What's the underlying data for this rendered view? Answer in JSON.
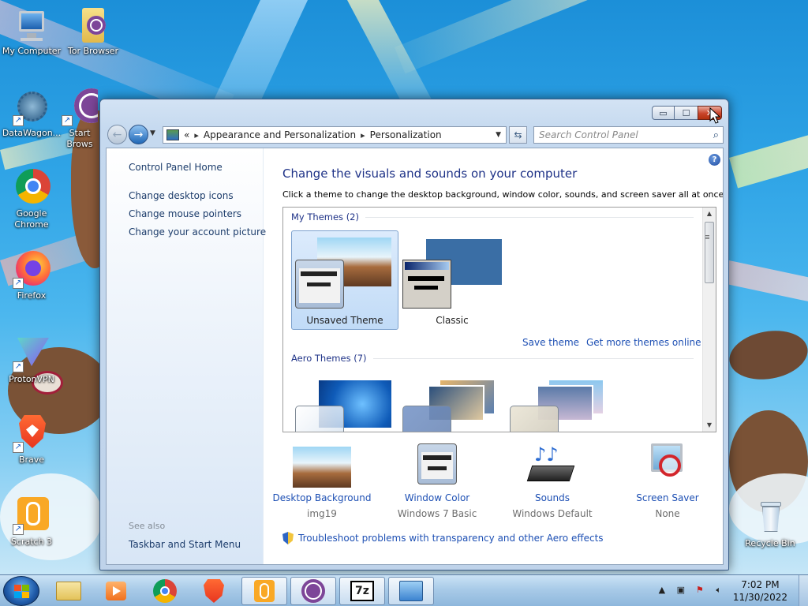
{
  "desktop": {
    "icons": [
      {
        "label": "My Computer",
        "icon": "computer-icon"
      },
      {
        "label": "Tor Browser",
        "icon": "tor-browser-icon"
      },
      {
        "label": "DataWagon...",
        "icon": "datawagon-icon"
      },
      {
        "label": "Start\nBrows",
        "icon": "start-browser-icon"
      },
      {
        "label": "Google\nChrome",
        "icon": "chrome-icon"
      },
      {
        "label": "Firefox",
        "icon": "firefox-icon"
      },
      {
        "label": "ProtonVPN",
        "icon": "protonvpn-icon"
      },
      {
        "label": "Brave",
        "icon": "brave-icon"
      },
      {
        "label": "Scratch 3",
        "icon": "scratch-icon"
      },
      {
        "label": "Recycle Bin",
        "icon": "recycle-bin-icon"
      }
    ]
  },
  "window": {
    "caption_buttons": {
      "minimize": "▭",
      "maximize": "☐",
      "close": "✕"
    },
    "address": {
      "chevron": "«",
      "crumbs": [
        "Appearance and Personalization",
        "Personalization"
      ],
      "separator": "▸"
    },
    "search": {
      "placeholder": "Search Control Panel"
    },
    "sidebar": {
      "home": "Control Panel Home",
      "links": [
        "Change desktop icons",
        "Change mouse pointers",
        "Change your account picture"
      ],
      "see_also_label": "See also",
      "see_also_links": [
        "Taskbar and Start Menu"
      ]
    },
    "main": {
      "heading": "Change the visuals and sounds on your computer",
      "subtext": "Click a theme to change the desktop background, window color, sounds, and screen saver all at once.",
      "groups": [
        {
          "title": "My Themes (2)"
        },
        {
          "title": "Aero Themes (7)"
        }
      ],
      "my_themes": [
        {
          "label": "Unsaved Theme",
          "selected": true
        },
        {
          "label": "Classic",
          "selected": false
        }
      ],
      "save_theme": "Save theme",
      "more_themes": "Get more themes online",
      "bottom": [
        {
          "title": "Desktop Background",
          "sub": "img19",
          "icon": "desktop-background-icon"
        },
        {
          "title": "Window Color",
          "sub": "Windows 7 Basic",
          "icon": "window-color-icon"
        },
        {
          "title": "Sounds",
          "sub": "Windows Default",
          "icon": "sounds-icon"
        },
        {
          "title": "Screen Saver",
          "sub": "None",
          "icon": "screen-saver-icon"
        }
      ],
      "troubleshoot": "Troubleshoot problems with transparency and other Aero effects"
    }
  },
  "taskbar": {
    "pinned": [
      "file-explorer-icon",
      "media-player-icon",
      "chrome-icon",
      "brave-icon",
      "scratch-icon",
      "tor-browser-icon",
      "7zip-icon",
      "control-panel-icon"
    ],
    "seven_zip_label": "7z",
    "clock": {
      "time": "7:02 PM",
      "date": "11/30/2022"
    }
  },
  "colors": {
    "accent_link": "#1e50b4",
    "heading": "#1e3287",
    "close_button": "#c9452b"
  }
}
